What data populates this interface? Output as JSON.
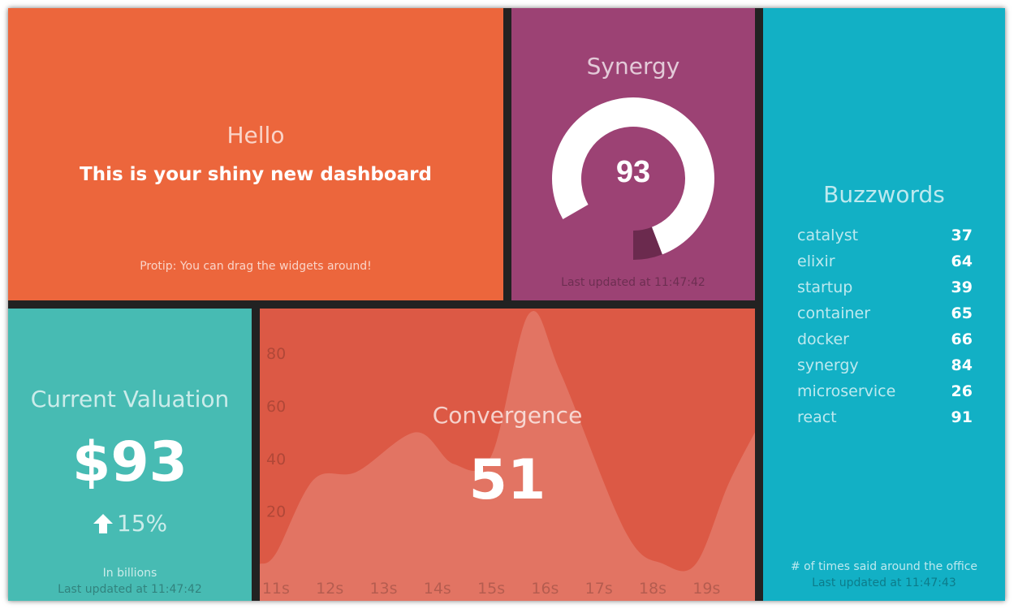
{
  "hello": {
    "title": "Hello",
    "text": "This is your shiny new dashboard",
    "protip": "Protip: You can drag the widgets around!"
  },
  "synergy": {
    "title": "Synergy",
    "value": 93,
    "max": 100,
    "value_label": "93",
    "updated": "Last updated at 11:47:42",
    "colors": {
      "track": "#ffffff",
      "fill": "#6b2a4e"
    }
  },
  "buzzwords": {
    "title": "Buzzwords",
    "items": [
      {
        "label": "catalyst",
        "value": "37"
      },
      {
        "label": "elixir",
        "value": "64"
      },
      {
        "label": "startup",
        "value": "39"
      },
      {
        "label": "container",
        "value": "65"
      },
      {
        "label": "docker",
        "value": "66"
      },
      {
        "label": "synergy",
        "value": "84"
      },
      {
        "label": "microservice",
        "value": "26"
      },
      {
        "label": "react",
        "value": "91"
      }
    ],
    "more_info": "# of times said around the office",
    "updated": "Last updated at 11:47:43"
  },
  "valuation": {
    "title": "Current Valuation",
    "value": "$93",
    "change_icon": "arrow-up-icon",
    "change": "15%",
    "more_info": "In billions",
    "updated": "Last updated at 11:47:42"
  },
  "convergence": {
    "title": "Convergence",
    "value": "51"
  },
  "chart_data": {
    "type": "area",
    "x": [
      10.7,
      11,
      11.7,
      12.5,
      13.6,
      14.3,
      15,
      15.7,
      16.3,
      17.5,
      18.2,
      18.8,
      19.4,
      19.9
    ],
    "y": [
      0,
      4,
      32,
      35,
      50,
      38,
      41,
      95,
      72,
      12,
      0,
      0,
      30,
      50
    ],
    "xticks": [
      "11s",
      "12s",
      "13s",
      "14s",
      "15s",
      "16s",
      "17s",
      "18s",
      "19s"
    ],
    "yticks": [
      "20",
      "40",
      "60",
      "80"
    ],
    "xlim": [
      10.7,
      19.9
    ],
    "ylim": [
      -14,
      97
    ],
    "colors": {
      "background": "#dc5945",
      "area": "#e27463"
    }
  },
  "colors": {
    "frame": "#222222",
    "hello": "#ec663c",
    "synergy": "#9c4274",
    "buzzwords": "#12b0c5",
    "valuation": "#47bbb3",
    "convergence": "#dc5945"
  }
}
